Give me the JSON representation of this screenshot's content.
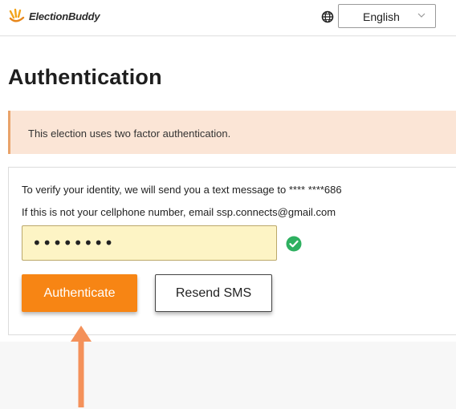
{
  "header": {
    "brand": "ElectionBuddy",
    "language": {
      "selected": "English"
    }
  },
  "page": {
    "title": "Authentication",
    "alert": "This election uses two factor authentication.",
    "verify_text": "To verify your identity, we will send you a text message to **** ****686",
    "help_text": "If this is not your cellphone number, email ssp.connects@gmail.com",
    "code_input": {
      "value": "••••••••"
    },
    "authenticate_label": "Authenticate",
    "resend_label": "Resend SMS"
  },
  "colors": {
    "brand_orange": "#f78514",
    "alert_bg": "#fbe5d6",
    "success_green": "#2eb060",
    "arrow": "#f4915a"
  },
  "icons": {
    "logo": "hands-logo-icon",
    "globe": "globe-icon",
    "caret": "chevron-down-icon",
    "check": "check-circle-icon",
    "arrow": "arrow-up-icon"
  }
}
